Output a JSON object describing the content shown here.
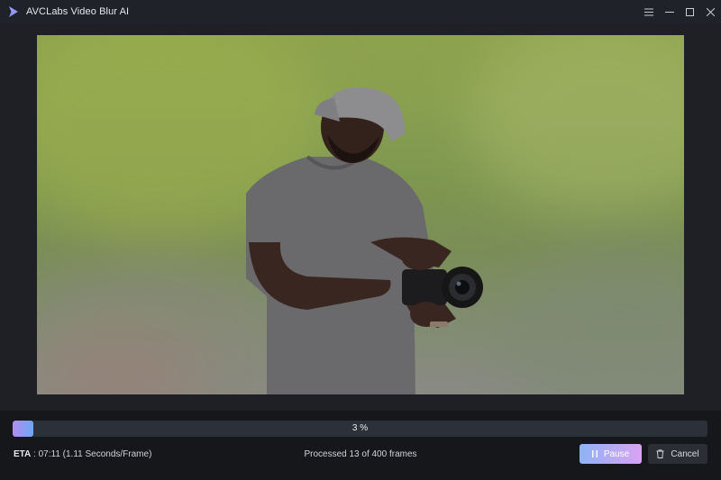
{
  "window": {
    "title": "AVCLabs Video Blur AI",
    "controls": [
      "menu-icon",
      "minimize-icon",
      "maximize-icon",
      "close-icon"
    ]
  },
  "preview": {
    "subject": "person with camera"
  },
  "progress": {
    "percent": 3,
    "label": "3 %"
  },
  "status": {
    "eta_label": "ETA",
    "eta_value": " : 07:11 (1.11 Seconds/Frame)",
    "processed_text": "Processed 13 of 400 frames"
  },
  "buttons": {
    "pause_label": "Pause",
    "cancel_label": "Cancel"
  },
  "colors": {
    "accent_start": "#b48cf2",
    "accent_end": "#6aa8f5",
    "pause_gradient": [
      "#8fb2f6",
      "#d9a3f2"
    ]
  }
}
